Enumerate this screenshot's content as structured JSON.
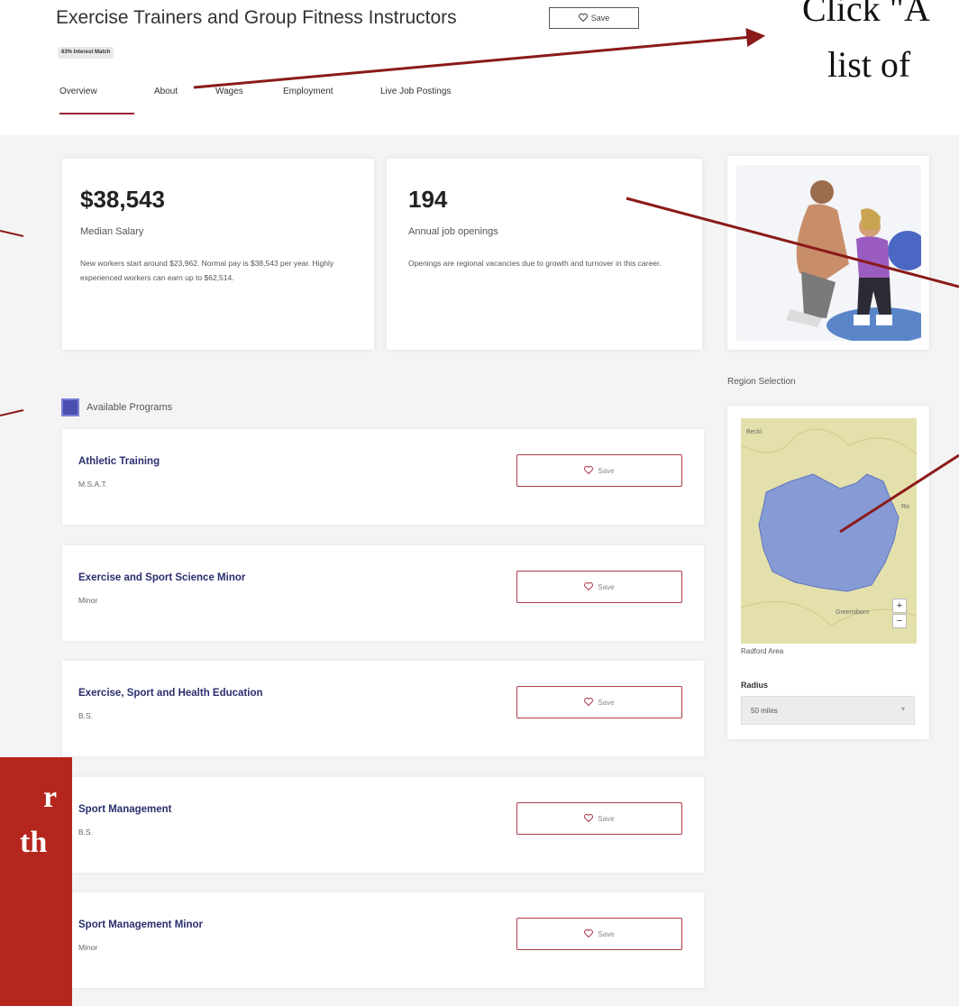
{
  "header": {
    "title": "Exercise Trainers and Group Fitness Instructors",
    "save_label": "Save",
    "badge": "63% Interest Match"
  },
  "tabs": [
    {
      "label": "Overview",
      "active": true
    },
    {
      "label": "About"
    },
    {
      "label": "Wages"
    },
    {
      "label": "Employment"
    },
    {
      "label": "Live Job Postings"
    }
  ],
  "stats": {
    "salary": {
      "value": "$38,543",
      "label": "Median Salary",
      "description": "New workers start around $23,962. Normal pay is $38,543 per year. Highly experienced workers can earn up to $62,514."
    },
    "openings": {
      "value": "194",
      "label": "Annual job openings",
      "description": "Openings are regional vacancies due to growth and turnover in this career."
    }
  },
  "programs": {
    "title": "Available Programs",
    "items": [
      {
        "name": "Athletic Training",
        "degree": "M.S.A.T.",
        "save_label": "Save"
      },
      {
        "name": "Exercise and Sport Science Minor",
        "degree": "Minor",
        "save_label": "Save"
      },
      {
        "name": "Exercise, Sport and Health Education",
        "degree": "B.S.",
        "save_label": "Save"
      },
      {
        "name": "Sport Management",
        "degree": "B.S.",
        "save_label": "Save"
      },
      {
        "name": "Sport Management Minor",
        "degree": "Minor",
        "save_label": "Save"
      }
    ]
  },
  "region": {
    "title": "Region Selection",
    "area_name": "Radford Area",
    "map_labels": {
      "top_left": "Beckl",
      "right": "Ro",
      "bottom": "Greensboro"
    },
    "zoom_in": "+",
    "zoom_out": "−",
    "radius_label": "Radius",
    "radius_value": "50 miles"
  },
  "annotations": {
    "callout_line1": "Click \"A",
    "callout_line2": "list of",
    "panel_line1": "r",
    "panel_line2": "th"
  },
  "colors": {
    "accent": "#9b2335",
    "annotation_arrow": "#8b1a1a",
    "link_navy": "#2a2f6e",
    "map_region": "#7b93d9",
    "panel_red": "#b5261e"
  }
}
